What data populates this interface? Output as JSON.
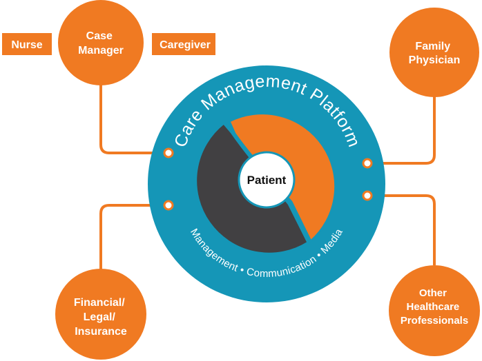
{
  "colors": {
    "orange": "#F07A22",
    "teal": "#1596B7",
    "dark": "#414042",
    "white": "#FFFFFF"
  },
  "platform": {
    "title": "Care Management Platform",
    "subtitle": "Management • Communication • Media"
  },
  "center": {
    "label": "Patient"
  },
  "nodes": {
    "case_manager": {
      "line1": "Case",
      "line2": "Manager"
    },
    "nurse": {
      "label": "Nurse"
    },
    "caregiver": {
      "label": "Caregiver"
    },
    "family_physician": {
      "line1": "Family",
      "line2": "Physician"
    },
    "financial": {
      "line1": "Financial/",
      "line2": "Legal/",
      "line3": "Insurance"
    },
    "other": {
      "line1": "Other",
      "line2": "Healthcare",
      "line3": "Professionals"
    }
  }
}
